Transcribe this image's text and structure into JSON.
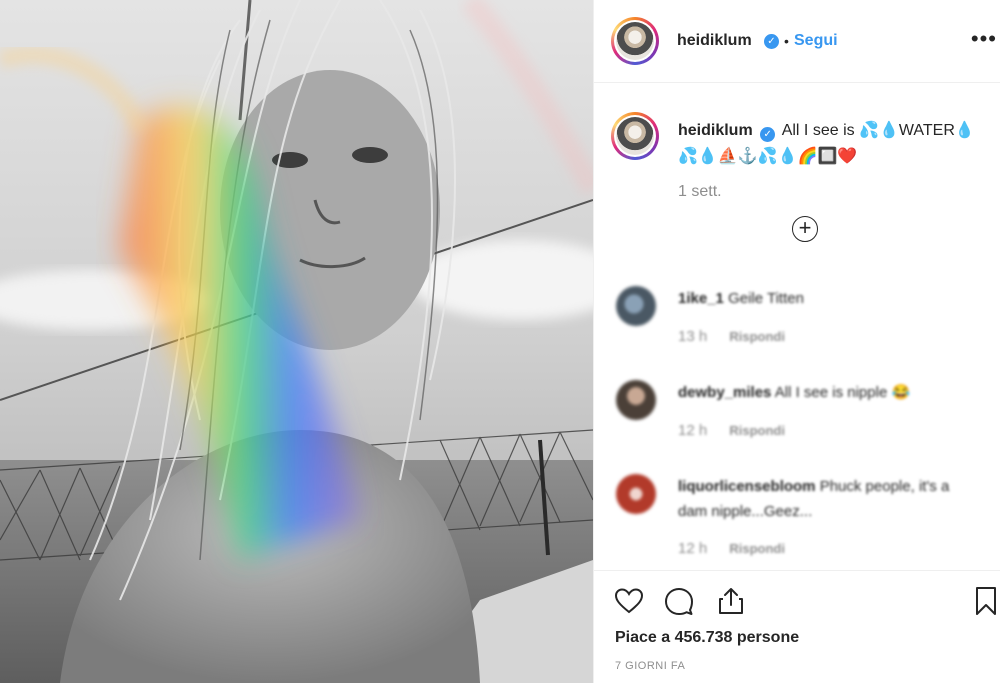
{
  "post": {
    "image_alt": "photo"
  },
  "header": {
    "username": "heidiklum",
    "separator": "•",
    "follow_label": "Segui",
    "more_label": "•••"
  },
  "caption": {
    "username": "heidiklum",
    "text": "All I see is 💦💧WATER💧💦💧⛵⚓💦💧🌈🔲❤️",
    "time_ago": "1 sett."
  },
  "load_more_label": "+",
  "comments": [
    {
      "username": "1ike_1",
      "text": "Geile Titten",
      "time": "13 h",
      "reply_label": "Rispondi"
    },
    {
      "username": "dewby_miles",
      "text": "All I see is nipple 😂",
      "time": "12 h",
      "reply_label": "Rispondi"
    },
    {
      "username": "liquorlicensebloom",
      "text": "Phuck people, it's a dam nipple...Geez...",
      "time": "12 h",
      "reply_label": "Rispondi"
    }
  ],
  "actions": {
    "like_icon": "heart-icon",
    "comment_icon": "comment-bubble-icon",
    "share_icon": "share-upload-icon",
    "save_icon": "bookmark-icon"
  },
  "likes_text": "Piace a 456.738 persone",
  "date_text": "7 GIORNI FA",
  "colors": {
    "link_blue": "#3897f0",
    "text": "#262626",
    "muted": "#8e8e8e",
    "border": "#efefef"
  }
}
